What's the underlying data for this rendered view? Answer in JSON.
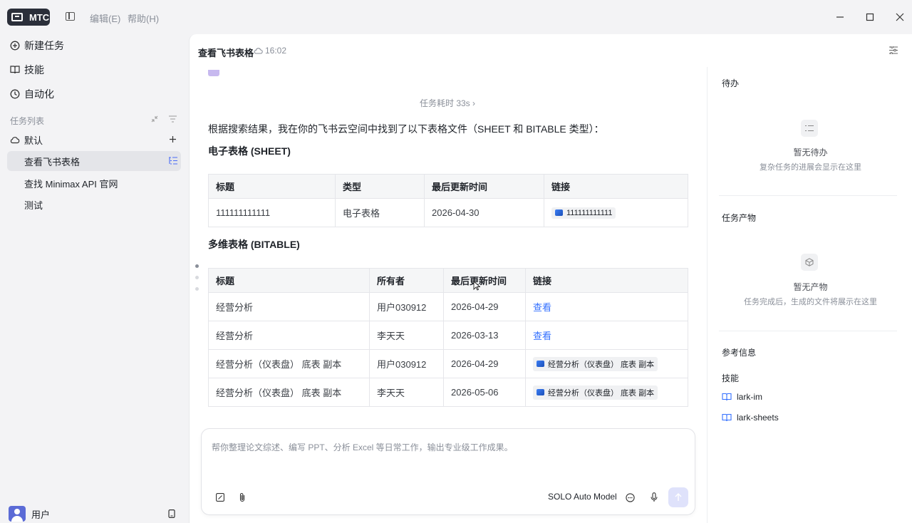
{
  "app": {
    "name": "MTC",
    "menu": [
      "编辑(E)",
      "帮助(H)"
    ]
  },
  "sidebar": {
    "nav": [
      {
        "label": "新建任务",
        "icon": "new-task-icon"
      },
      {
        "label": "技能",
        "icon": "book-icon"
      },
      {
        "label": "自动化",
        "icon": "clock-icon"
      }
    ],
    "section": "任务列表",
    "group": "默认",
    "tasks": [
      "查看飞书表格",
      "查找 Minimax API 官网",
      "测试"
    ],
    "user": "用户"
  },
  "main": {
    "title": "查看飞书表格",
    "time": "16:02",
    "elapsed": "任务耗时 33s",
    "intro": "根据搜索结果，我在你的飞书云空间中找到了以下表格文件（SHEET 和 BITABLE 类型）：",
    "sheet_heading": "电子表格 (SHEET)",
    "sheet_table": {
      "headers": [
        "标题",
        "类型",
        "最后更新时间",
        "链接"
      ],
      "rows": [
        [
          "111111111111",
          "电子表格",
          "2026-04-30",
          "111111111111"
        ]
      ]
    },
    "bitable_heading": "多维表格 (BITABLE)",
    "bitable_table": {
      "headers": [
        "标题",
        "所有者",
        "最后更新时间",
        "链接"
      ],
      "rows": [
        [
          "经营分析",
          "用户030912",
          "2026-04-29",
          "查看"
        ],
        [
          "经营分析",
          "李天天",
          "2026-03-13",
          "查看"
        ],
        [
          "经营分析（仪表盘） 底表 副本",
          "用户030912",
          "2026-04-29",
          "经营分析（仪表盘） 底表 副本"
        ],
        [
          "经营分析（仪表盘） 底表 副本",
          "李天天",
          "2026-05-06",
          "经营分析（仪表盘） 底表 副本"
        ]
      ]
    },
    "composer": {
      "placeholder": "帮你整理论文综述、编写 PPT、分析 Excel 等日常工作，输出专业级工作成果。",
      "model": "SOLO Auto Model"
    }
  },
  "right": {
    "todo_title": "待办",
    "todo_empty": "暂无待办",
    "todo_hint": "复杂任务的进展会显示在这里",
    "output_title": "任务产物",
    "output_empty": "暂无产物",
    "output_hint": "任务完成后，生成的文件将展示在这里",
    "ref_title": "参考信息",
    "skills_label": "技能",
    "skills": [
      "lark-im",
      "lark-sheets"
    ]
  }
}
